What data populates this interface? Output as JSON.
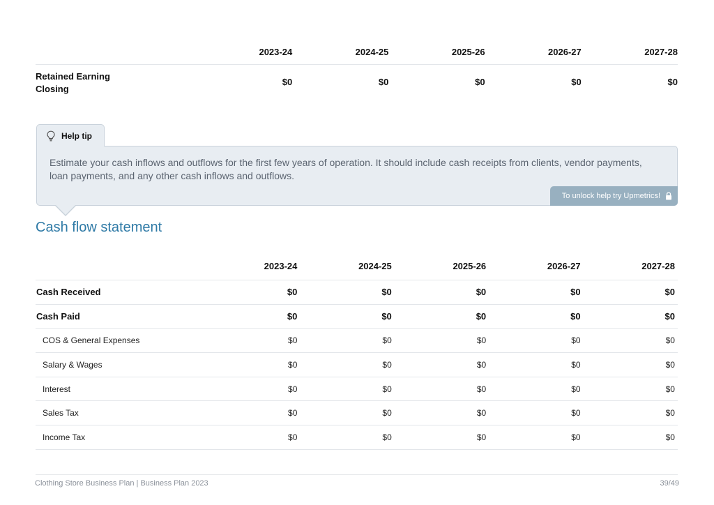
{
  "top_table": {
    "years": [
      "2023-24",
      "2024-25",
      "2025-26",
      "2026-27",
      "2027-28"
    ],
    "row": {
      "label": "Retained Earning Closing",
      "values": [
        "$0",
        "$0",
        "$0",
        "$0",
        "$0"
      ]
    }
  },
  "help_tip": {
    "label": "Help tip",
    "text": "Estimate your cash inflows and outflows for the first few years of operation. It should include cash receipts from clients, vendor payments, loan payments, and any other cash inflows and outflows.",
    "unlock_text": "To unlock help try Upmetrics!"
  },
  "cash_flow": {
    "title": "Cash flow statement",
    "years": [
      "2023-24",
      "2024-25",
      "2025-26",
      "2026-27",
      "2027-28"
    ],
    "rows": [
      {
        "label": "Cash Received",
        "values": [
          "$0",
          "$0",
          "$0",
          "$0",
          "$0"
        ]
      },
      {
        "label": "Cash Paid",
        "values": [
          "$0",
          "$0",
          "$0",
          "$0",
          "$0"
        ]
      },
      {
        "label": "COS & General Expenses",
        "values": [
          "$0",
          "$0",
          "$0",
          "$0",
          "$0"
        ]
      },
      {
        "label": "Salary & Wages",
        "values": [
          "$0",
          "$0",
          "$0",
          "$0",
          "$0"
        ]
      },
      {
        "label": "Interest",
        "values": [
          "$0",
          "$0",
          "$0",
          "$0",
          "$0"
        ]
      },
      {
        "label": "Sales Tax",
        "values": [
          "$0",
          "$0",
          "$0",
          "$0",
          "$0"
        ]
      },
      {
        "label": "Income Tax",
        "values": [
          "$0",
          "$0",
          "$0",
          "$0",
          "$0"
        ]
      }
    ]
  },
  "footer": {
    "left": "Clothing Store Business Plan | Business Plan 2023",
    "right": "39/49"
  },
  "colors": {
    "accent": "#2f7aa6",
    "tip_background": "#e8edf2",
    "unlock_background": "#98b0c0"
  },
  "icons": {
    "help_tip": "lightbulb-icon",
    "unlock": "lock-icon"
  }
}
